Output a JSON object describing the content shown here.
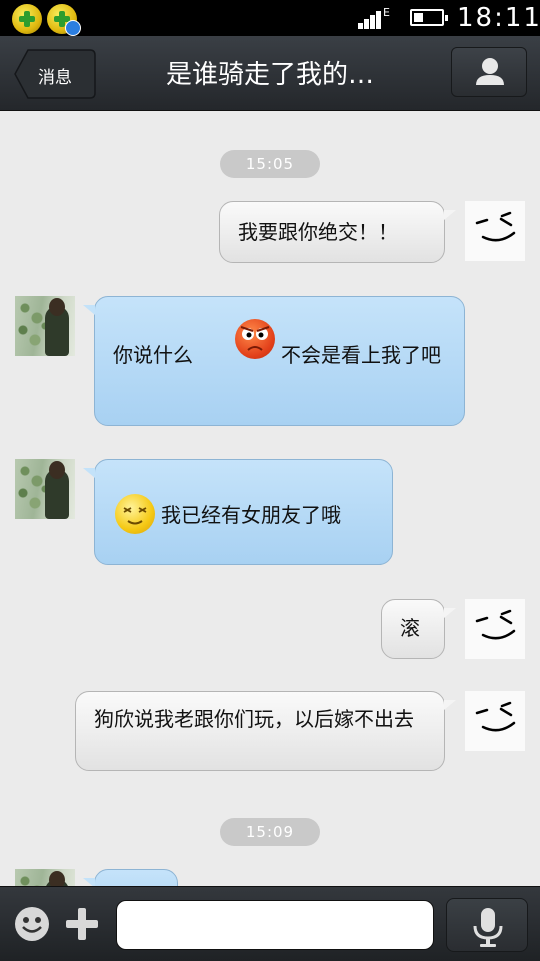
{
  "status_bar": {
    "time": "18:11",
    "network": "E",
    "app_icons": [
      "360-security-plus-icon",
      "360-update-icon"
    ]
  },
  "header": {
    "back_label": "消息",
    "title": "是谁骑走了我的…"
  },
  "messages": [
    {
      "type": "time",
      "text": "15:05"
    },
    {
      "side": "right",
      "text": "我要跟你绝交！！"
    },
    {
      "side": "left",
      "text_before": "你说什么",
      "emoji": "angry-face-emoji",
      "text_after": "不会是看上我了吧"
    },
    {
      "side": "left",
      "emoji": "smile-face-emoji",
      "text": "我已经有女朋友了哦"
    },
    {
      "side": "right",
      "text": "滚"
    },
    {
      "side": "right",
      "text": "狗欣说我老跟你们玩，以后嫁不出去"
    },
    {
      "type": "time",
      "text": "15:09"
    }
  ],
  "input": {
    "value": ""
  },
  "colors": {
    "outgoing_bubble": "#ececec",
    "incoming_bubble": "#b7dbf6",
    "header_bg": "#2e3237",
    "chat_bg": "#ebebeb"
  }
}
